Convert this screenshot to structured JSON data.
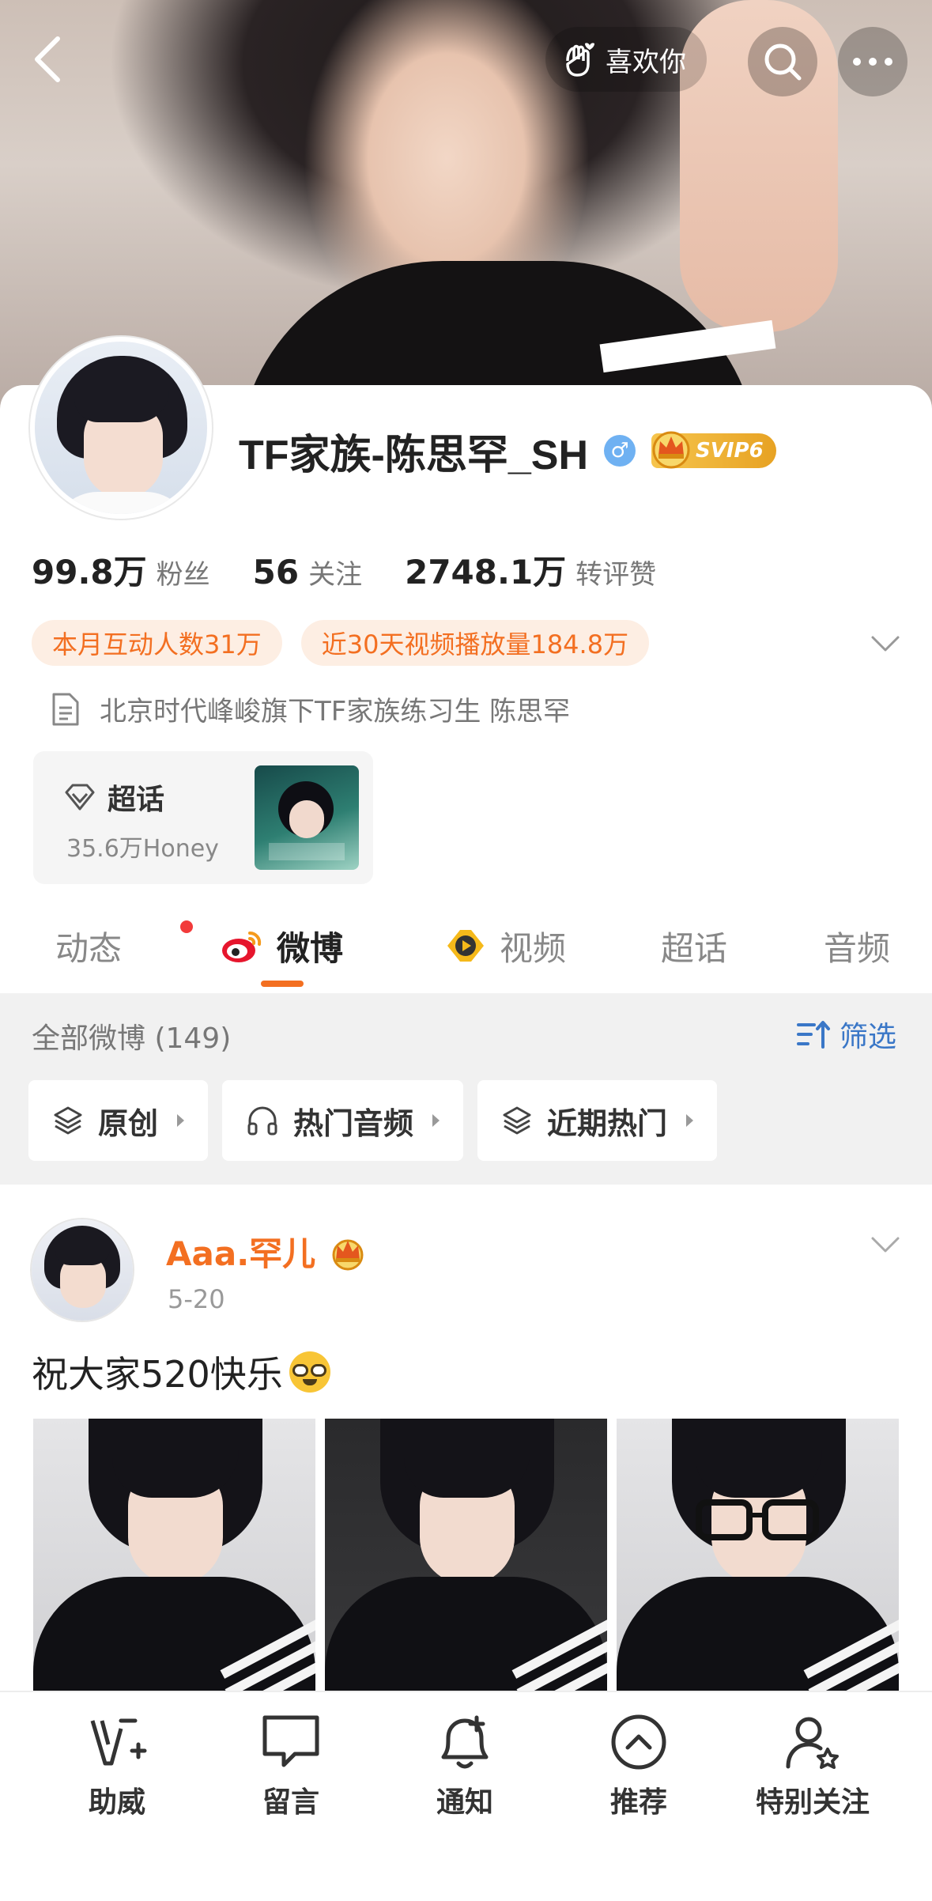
{
  "header": {
    "like_label": "喜欢你"
  },
  "profile": {
    "name": "TF家族-陈思罕_SH",
    "gender_symbol": "♂",
    "vip_label": "SVIP6",
    "stats": [
      {
        "value": "99.8万",
        "label": "粉丝"
      },
      {
        "value": "56",
        "label": "关注"
      },
      {
        "value": "2748.1万",
        "label": "转评赞"
      }
    ],
    "tags": [
      "本月互动人数31万",
      "近30天视频播放量184.8万"
    ],
    "bio": "北京时代峰峻旗下TF家族练习生 陈思罕",
    "supertopic": {
      "title": "超话",
      "subtitle": "35.6万Honey"
    }
  },
  "tabs": [
    {
      "label": "动态",
      "has_dot": true
    },
    {
      "label": "微博",
      "active": true
    },
    {
      "label": "视频"
    },
    {
      "label": "超话"
    },
    {
      "label": "音频"
    }
  ],
  "feed": {
    "all_count": "全部微博 (149)",
    "filter_label": "筛选",
    "chips": [
      "原创",
      "热门音频",
      "近期热门"
    ]
  },
  "post": {
    "author": "Aaa.罕儿",
    "date": "5-20",
    "text": "祝大家520快乐"
  },
  "bottom_nav": [
    {
      "label": "助威",
      "icon": "cheer-icon"
    },
    {
      "label": "留言",
      "icon": "message-icon"
    },
    {
      "label": "通知",
      "icon": "bell-plus-icon"
    },
    {
      "label": "推荐",
      "icon": "recommend-icon"
    },
    {
      "label": "特别关注",
      "icon": "special-follow-icon"
    }
  ],
  "colors": {
    "accent": "#f36f21",
    "link_blue": "#3a77c7",
    "vip_gold": "#f0b233",
    "gender_blue": "#6fb1f2"
  }
}
